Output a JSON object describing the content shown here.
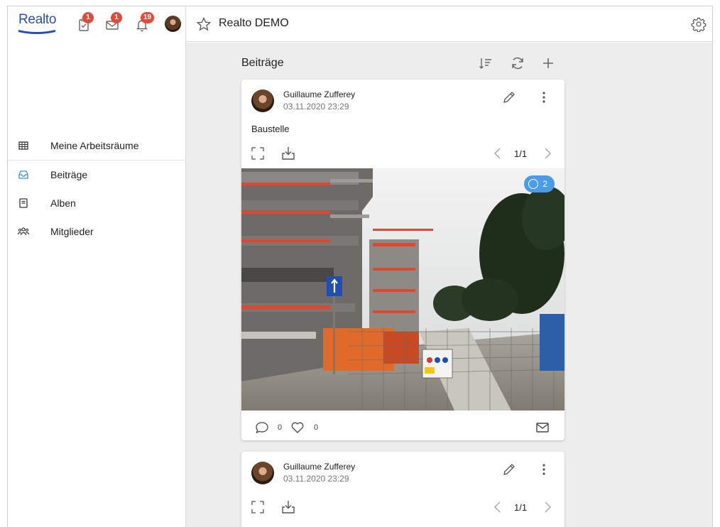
{
  "app": {
    "logo_text": "Realto",
    "brand_color": "#2c4fb3"
  },
  "top_icons": {
    "tasks": {
      "icon": "clipboard-check-icon",
      "badge": "1"
    },
    "messages": {
      "icon": "envelope-icon",
      "badge": "1"
    },
    "notifications": {
      "icon": "bell-icon",
      "badge": "19"
    }
  },
  "header": {
    "workspace_title": "Realto DEMO"
  },
  "sidebar": {
    "items": [
      {
        "label": "Meine Arbeitsräume",
        "icon": "grid-icon"
      },
      {
        "label": "Beiträge",
        "icon": "inbox-icon",
        "active": true
      },
      {
        "label": "Alben",
        "icon": "album-icon"
      },
      {
        "label": "Mitglieder",
        "icon": "members-icon"
      }
    ]
  },
  "feed": {
    "title": "Beiträge",
    "posts": [
      {
        "author": "Guillaume Zufferey",
        "date": "03.11.2020 23:29",
        "text": "Baustelle",
        "pager": "1/1",
        "comment_badge": "2",
        "comments": "0",
        "likes": "0"
      },
      {
        "author": "Guillaume Zufferey",
        "date": "03.11.2020 23:29",
        "pager": "1/1"
      }
    ]
  }
}
